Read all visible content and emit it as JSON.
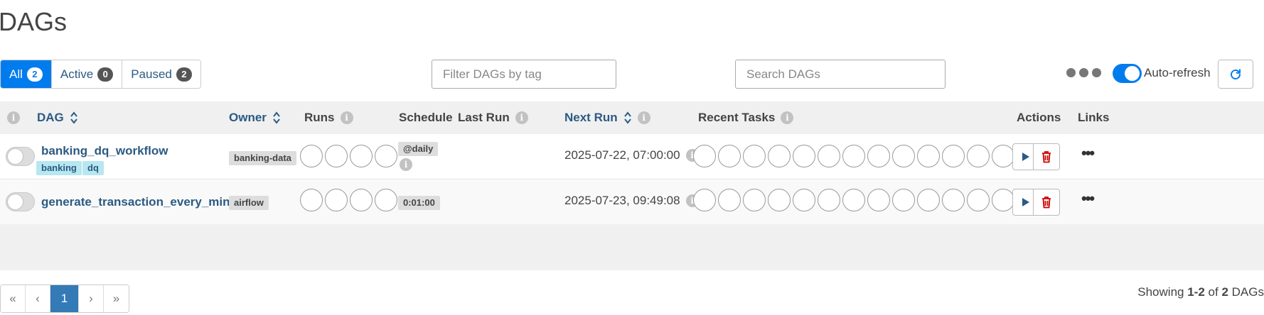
{
  "page": {
    "title": "DAGs"
  },
  "status_filter": {
    "all": {
      "label": "All",
      "count": "2"
    },
    "active": {
      "label": "Active",
      "count": "0"
    },
    "paused": {
      "label": "Paused",
      "count": "2"
    }
  },
  "tag_filter": {
    "placeholder": "Filter DAGs by tag",
    "value": ""
  },
  "search": {
    "placeholder": "Search DAGs",
    "value": ""
  },
  "auto_refresh": {
    "label": "Auto-refresh",
    "enabled": true
  },
  "table": {
    "headers": {
      "dag": "DAG",
      "owner": "Owner",
      "runs": "Runs",
      "schedule": "Schedule",
      "last_run": "Last Run",
      "next_run": "Next Run",
      "recent_tasks": "Recent Tasks",
      "actions": "Actions",
      "links": "Links"
    },
    "rows": [
      {
        "dag_id": "banking_dq_workflow",
        "tags": [
          "banking",
          "dq"
        ],
        "owner": "banking-data",
        "schedule": "@daily",
        "last_run": "",
        "next_run": "2025-07-22, 07:00:00",
        "paused": true
      },
      {
        "dag_id": "generate_transaction_every_minute",
        "tags": [],
        "owner": "airflow",
        "schedule": "0:01:00",
        "last_run": "",
        "next_run": "2025-07-23, 09:49:08",
        "paused": true
      }
    ]
  },
  "pagination": {
    "first": "«",
    "prev": "‹",
    "current": "1",
    "next": "›",
    "last": "»"
  },
  "showing": {
    "prefix": "Showing",
    "range": "1-2",
    "of": "of",
    "total": "2",
    "suffix": "DAGs"
  },
  "colors": {
    "primary": "#017cee",
    "link": "#2b5a83",
    "tag_bg": "#b7e7f0",
    "delete": "#cc0000"
  }
}
